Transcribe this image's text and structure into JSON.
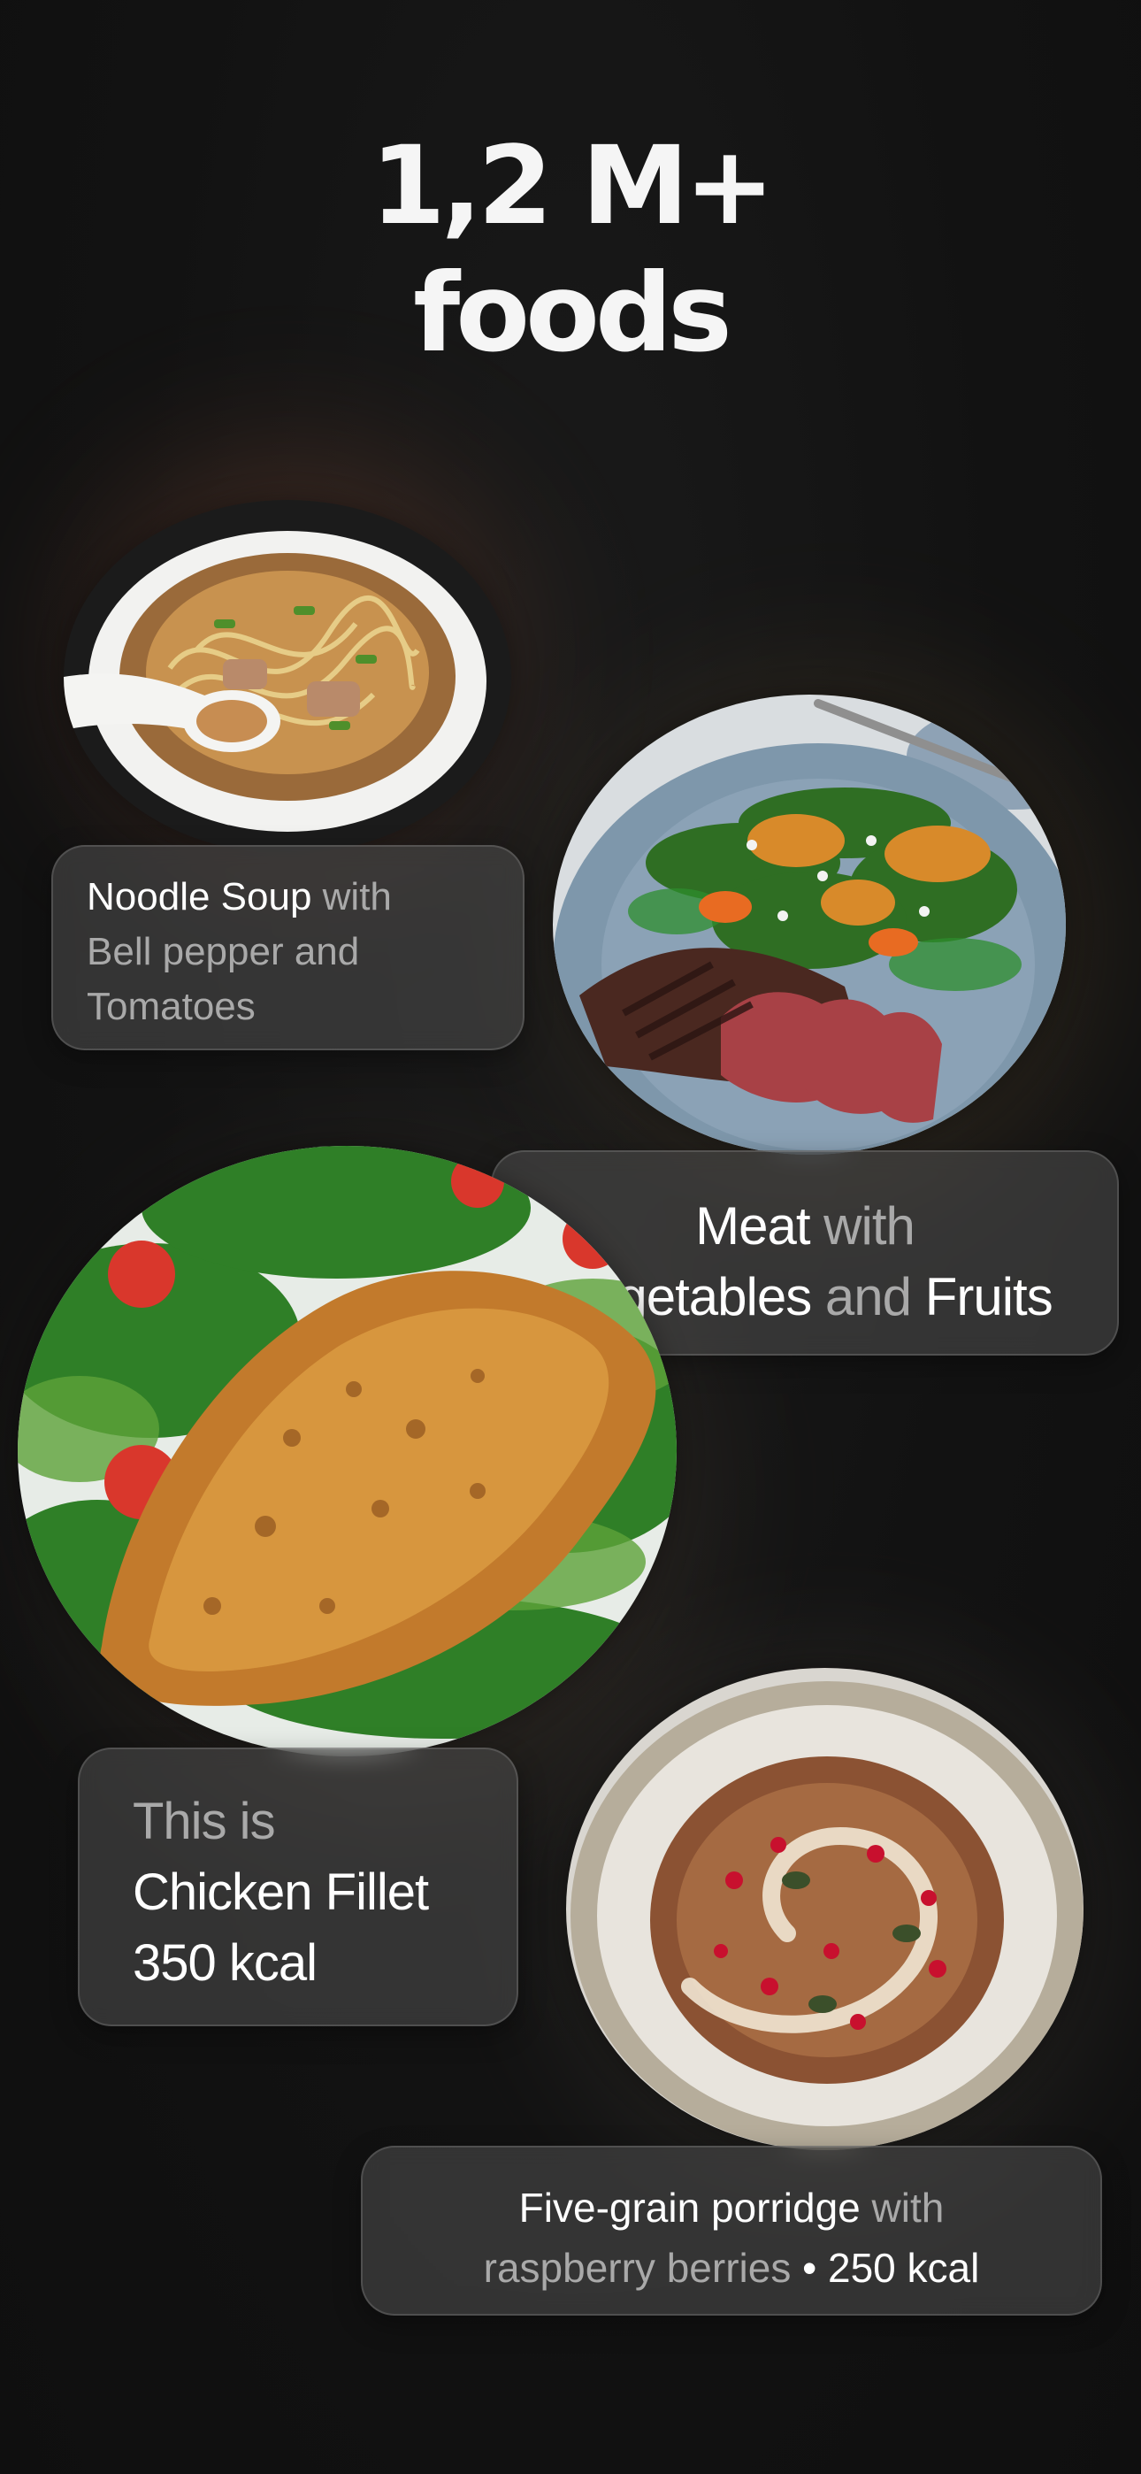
{
  "headline": {
    "line1": "1,2 M+",
    "line2": "foods"
  },
  "cards": {
    "soup": {
      "name": "Noodle Soup",
      "with": "with",
      "line2": "Bell pepper and",
      "line3": "Tomatoes",
      "image_icon": "noodle-soup-image"
    },
    "steak": {
      "name": "Meat",
      "with": "with",
      "veg": "Vegetables",
      "and": "and",
      "fruits": "Fruits",
      "image_icon": "steak-salad-image"
    },
    "chicken": {
      "intro": "This is",
      "name": "Chicken Fillet",
      "kcal": "350 kcal",
      "image_icon": "chicken-fillet-image"
    },
    "porridge": {
      "name": "Five-grain porridge",
      "with": "with",
      "detail": "raspberry berries",
      "separator": "•",
      "kcal": "250 kcal",
      "image_icon": "porridge-image"
    }
  },
  "colors": {
    "background": "#111111",
    "text_primary": "#ffffff",
    "text_muted": "#a9a9a9",
    "card_fill": "rgba(80,80,80,0.55)"
  }
}
